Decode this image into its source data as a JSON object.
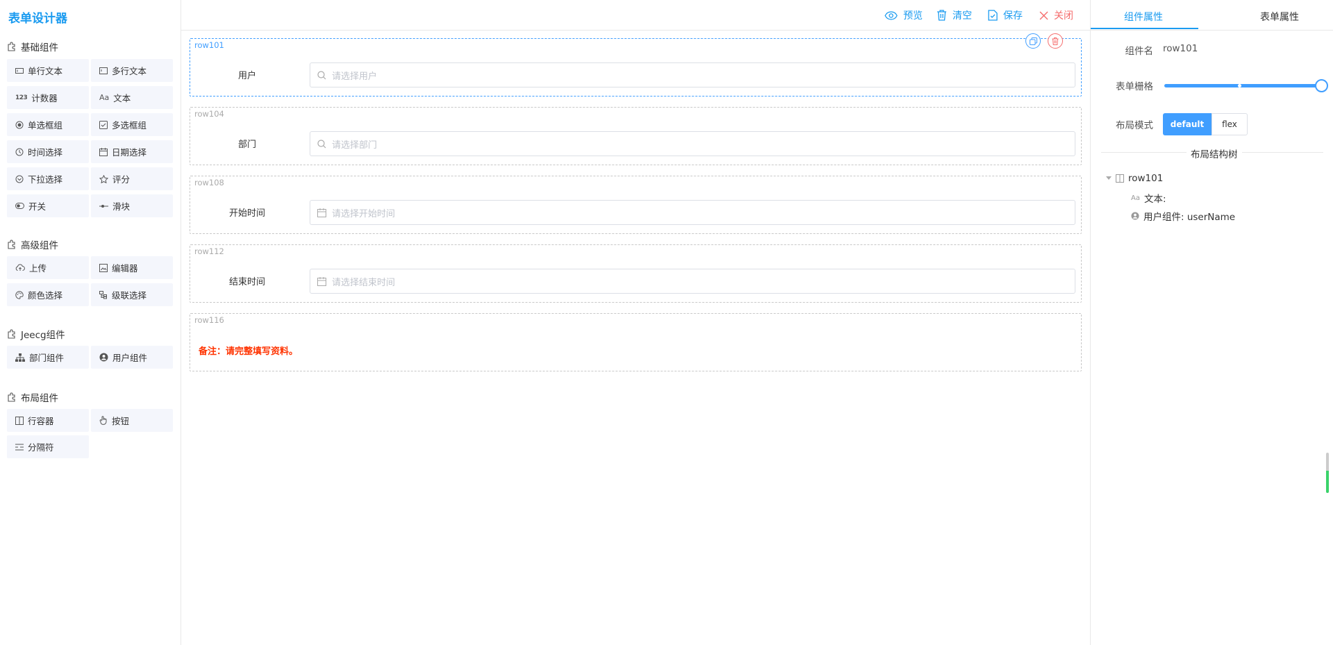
{
  "app": {
    "title": "表单设计器"
  },
  "toolbar": {
    "preview": "预览",
    "clear": "清空",
    "save": "保存",
    "close": "关闭"
  },
  "groups": [
    {
      "title": "基础组件",
      "items": [
        "单行文本",
        "多行文本",
        "计数器",
        "文本",
        "单选框组",
        "多选框组",
        "时间选择",
        "日期选择",
        "下拉选择",
        "评分",
        "开关",
        "滑块"
      ]
    },
    {
      "title": "高级组件",
      "items": [
        "上传",
        "编辑器",
        "颜色选择",
        "级联选择"
      ]
    },
    {
      "title": "Jeecg组件",
      "items": [
        "部门组件",
        "用户组件"
      ]
    },
    {
      "title": "布局组件",
      "items": [
        "行容器",
        "按钮",
        "分隔符"
      ]
    }
  ],
  "canvas": {
    "rows": [
      {
        "tag": "row101",
        "label": "用户",
        "placeholder": "请选择用户"
      },
      {
        "tag": "row104",
        "label": "部门",
        "placeholder": "请选择部门"
      },
      {
        "tag": "row108",
        "label": "开始时间",
        "placeholder": "请选择开始时间"
      },
      {
        "tag": "row112",
        "label": "结束时间",
        "placeholder": "请选择结束时间"
      },
      {
        "tag": "row116",
        "note": "备注：请完整填写资料。"
      }
    ]
  },
  "props": {
    "tabs": [
      "组件属性",
      "表单属性"
    ],
    "component_name_label": "组件名",
    "component_name_value": "row101",
    "gutter_label": "表单栅格",
    "gutter_level": 1.0,
    "layout_label": "布局模式",
    "layout_options": [
      "default",
      "flex"
    ],
    "layout_selected": "default",
    "tree_title": "布局结构树",
    "tree": {
      "root": "row101",
      "children": [
        "文本:",
        "用户组件: userName"
      ]
    }
  },
  "colors": {
    "primary": "#409eff",
    "brand": "#1a9bf0",
    "danger": "#f56c6c",
    "note": "#ff3300"
  }
}
